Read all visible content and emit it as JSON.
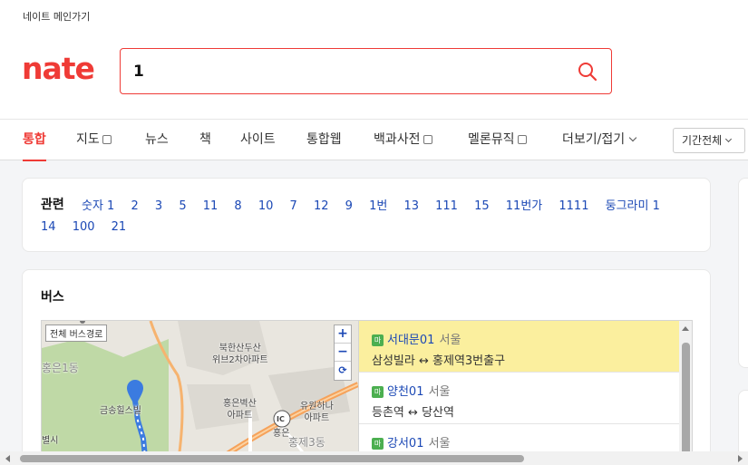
{
  "header": {
    "main_link": "네이트 메인가기",
    "logo": "nate",
    "search_value": "1"
  },
  "tabs": [
    {
      "label": "통합",
      "active": true
    },
    {
      "label": "지도",
      "checkbox": true
    },
    {
      "label": "뉴스"
    },
    {
      "label": "책"
    },
    {
      "label": "사이트"
    },
    {
      "label": "통합웹"
    },
    {
      "label": "백과사전",
      "checkbox": true
    },
    {
      "label": "멜론뮤직",
      "checkbox": true
    },
    {
      "label": "더보기/접기",
      "dropdown": true
    }
  ],
  "period_filter": "기간전체",
  "related": {
    "title": "관련",
    "links": [
      "숫자 1",
      "2",
      "3",
      "5",
      "11",
      "8",
      "10",
      "7",
      "12",
      "9",
      "1번",
      "13",
      "111",
      "15",
      "11번가",
      "1111",
      "둥그라미 1",
      "14",
      "100",
      "21"
    ]
  },
  "bus": {
    "title": "버스",
    "map": {
      "full_route_button": "전체 버스경로",
      "zoom_in": "+",
      "zoom_out": "−",
      "reset": "⟳",
      "labels": {
        "apt1": "북한산두산\n위브2차아파트",
        "apt2": "홍은벽산\n아파트",
        "apt3": "유원하나\n아파트",
        "ic": "IC",
        "hongeun": "홍은",
        "dong1": "홍제3동",
        "dong2": "홍은1동",
        "dong3": "부암동",
        "villa": "금송힐스빌",
        "byeolsi": "별시",
        "road": "내부순환로"
      }
    },
    "routes": [
      {
        "badge": "마",
        "name": "서대문01",
        "city": "서울",
        "from": "삼성빌라",
        "arrow": "↔",
        "to": "홍제역3번출구",
        "selected": true
      },
      {
        "badge": "마",
        "name": "양천01",
        "city": "서울",
        "from": "등촌역",
        "arrow": "↔",
        "to": "당산역",
        "selected": false
      },
      {
        "badge": "마",
        "name": "강서01",
        "city": "서울",
        "from": "",
        "arrow": "",
        "to": "",
        "selected": false
      }
    ]
  }
}
